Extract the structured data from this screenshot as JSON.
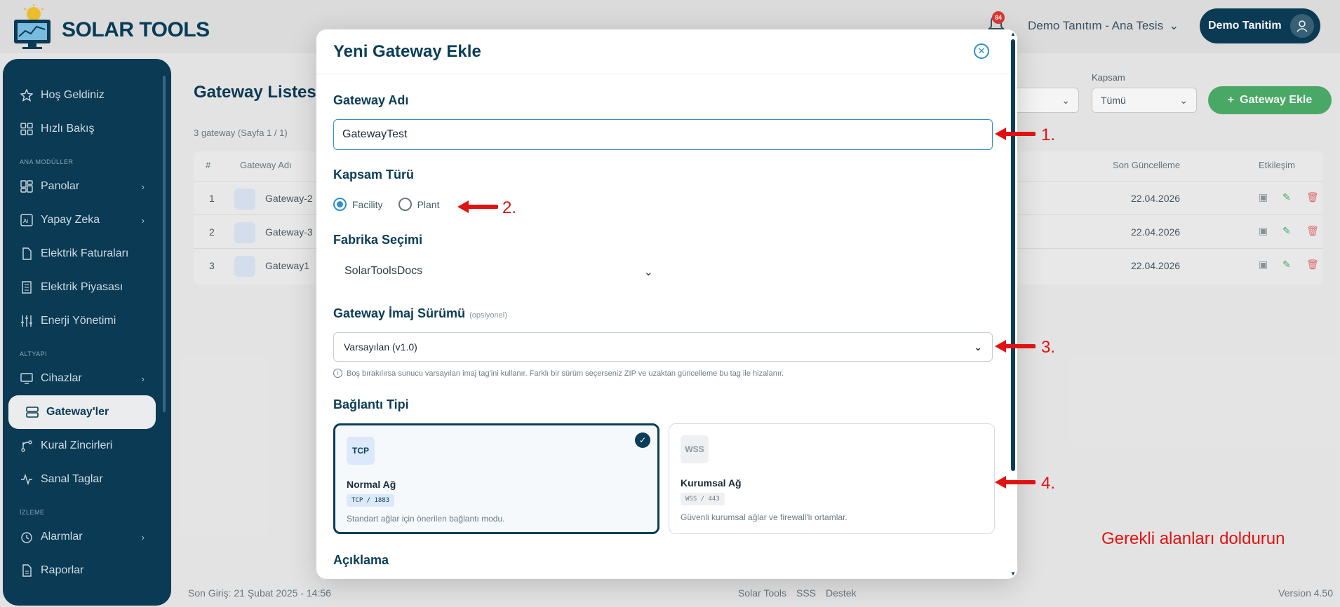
{
  "brand": {
    "name": "SOLAR TOOLS"
  },
  "topbar": {
    "notification_count": "84",
    "plant_selector": "Demo Tanıtım - Ana Tesis",
    "user_name": "Demo Tanitim"
  },
  "sidebar": {
    "items": [
      {
        "label": "Hoş Geldiniz",
        "icon": "star-icon"
      },
      {
        "label": "Hızlı Bakış",
        "icon": "grid-icon"
      }
    ],
    "section_main": "ANA MODÜLLER",
    "main_items": [
      {
        "label": "Panolar",
        "icon": "dashboard-icon",
        "chevron": true
      },
      {
        "label": "Yapay Zeka",
        "icon": "ai-icon",
        "chevron": true
      },
      {
        "label": "Elektrik Faturaları",
        "icon": "file-icon",
        "chevron": false
      },
      {
        "label": "Elektrik Piyasası",
        "icon": "building-icon",
        "chevron": false
      },
      {
        "label": "Enerji Yönetimi",
        "icon": "sliders-icon",
        "chevron": false
      }
    ],
    "section_infra": "ALTYAPI",
    "infra_items": [
      {
        "label": "Cihazlar",
        "icon": "monitor-icon",
        "chevron": true
      },
      {
        "label": "Gateway'ler",
        "icon": "server-icon",
        "active": true
      },
      {
        "label": "Kural Zincirleri",
        "icon": "branch-icon"
      },
      {
        "label": "Sanal Taglar",
        "icon": "activity-icon"
      }
    ],
    "section_monitor": "İZLEME",
    "monitor_items": [
      {
        "label": "Alarmlar",
        "icon": "alarm-icon",
        "chevron": true
      },
      {
        "label": "Raporlar",
        "icon": "report-icon"
      }
    ]
  },
  "page": {
    "title": "Gateway Listesi",
    "subtitle": "3 gateway (Sayfa 1 / 1)",
    "filter_label": "Kapsam",
    "filter_value": "Tümü",
    "add_button": "Gateway Ekle",
    "columns": [
      "#",
      "Gateway Adı",
      "Son Güncelleme",
      "Etkileşim"
    ],
    "rows": [
      {
        "no": "1",
        "name": "Gateway-2",
        "updated": "22.04.2026"
      },
      {
        "no": "2",
        "name": "Gateway-3",
        "updated": "22.04.2026"
      },
      {
        "no": "3",
        "name": "Gateway1",
        "updated": "22.04.2026"
      }
    ]
  },
  "footer": {
    "last_login": "Son Giriş: 21 Şubat 2025 - 14:56",
    "links": [
      "Solar Tools",
      "SSS",
      "Destek"
    ],
    "version": "Version 4.50"
  },
  "modal": {
    "title": "Yeni Gateway Ekle",
    "gateway_name_label": "Gateway Adı",
    "gateway_name_value": "GatewayTest",
    "scope_label": "Kapsam Türü",
    "scope_options": [
      "Facility",
      "Plant"
    ],
    "scope_selected": "Facility",
    "factory_label": "Fabrika Seçimi",
    "factory_value": "SolarToolsDocs",
    "image_label": "Gateway İmaj Sürümü",
    "image_optional": "(opsiyonel)",
    "image_value": "Varsayılan (v1.0)",
    "image_hint": "Boş bırakılırsa sunucu varsayılan imaj tag'ini kullanır. Farklı bir sürüm seçerseniz ZIP ve uzaktan güncelleme bu tag ile hizalanır.",
    "connection_label": "Bağlantı Tipi",
    "connections": [
      {
        "badge": "TCP",
        "title": "Normal Ağ",
        "code": "TCP / 1883",
        "desc": "Standart ağlar için önerilen bağlantı modu.",
        "selected": true
      },
      {
        "badge": "WSS",
        "title": "Kurumsal Ağ",
        "code": "WSS / 443",
        "desc": "Güvenli kurumsal ağlar ve firewall'lı ortamlar.",
        "selected": false
      }
    ],
    "description_label": "Açıklama"
  },
  "annotations": {
    "steps": [
      "1.",
      "2.",
      "3.",
      "4."
    ],
    "note": "Gerekli alanları doldurun",
    "color": "#e01212"
  }
}
